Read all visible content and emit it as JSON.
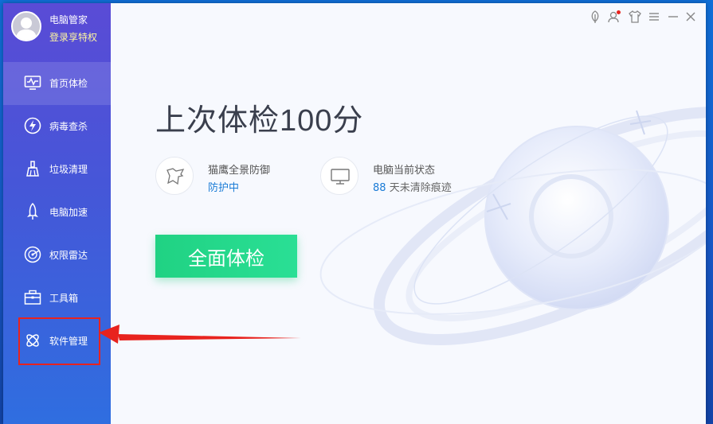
{
  "app": {
    "name": "电脑管家",
    "login_text": "登录享特权"
  },
  "sidebar": {
    "items": [
      {
        "label": "首页体检",
        "icon": "monitor-pulse-icon",
        "active": true
      },
      {
        "label": "病毒查杀",
        "icon": "lightning-shield-icon",
        "active": false
      },
      {
        "label": "垃圾清理",
        "icon": "broom-icon",
        "active": false
      },
      {
        "label": "电脑加速",
        "icon": "rocket-icon",
        "active": false
      },
      {
        "label": "权限雷达",
        "icon": "radar-icon",
        "active": false
      },
      {
        "label": "工具箱",
        "icon": "toolbox-icon",
        "active": false
      },
      {
        "label": "软件管理",
        "icon": "software-manager-icon",
        "active": false
      }
    ]
  },
  "titlebar": {
    "icons": [
      "leaf-icon",
      "user-notification-icon",
      "skin-shirt-icon",
      "menu-icon",
      "minimize-icon",
      "close-icon"
    ]
  },
  "main": {
    "headline": "上次体检100分",
    "protection": {
      "title": "猫鹰全景防御",
      "status": "防护中"
    },
    "computer_state": {
      "title": "电脑当前状态",
      "days": "88",
      "suffix": "天未清除痕迹"
    },
    "scan_button": "全面体检"
  },
  "colors": {
    "accent_green": "#22d88a",
    "link_blue": "#1a7bd6",
    "sidebar_top": "#5a4bd6",
    "sidebar_bottom": "#2f6ee0",
    "annotation_red": "#e8231e"
  }
}
